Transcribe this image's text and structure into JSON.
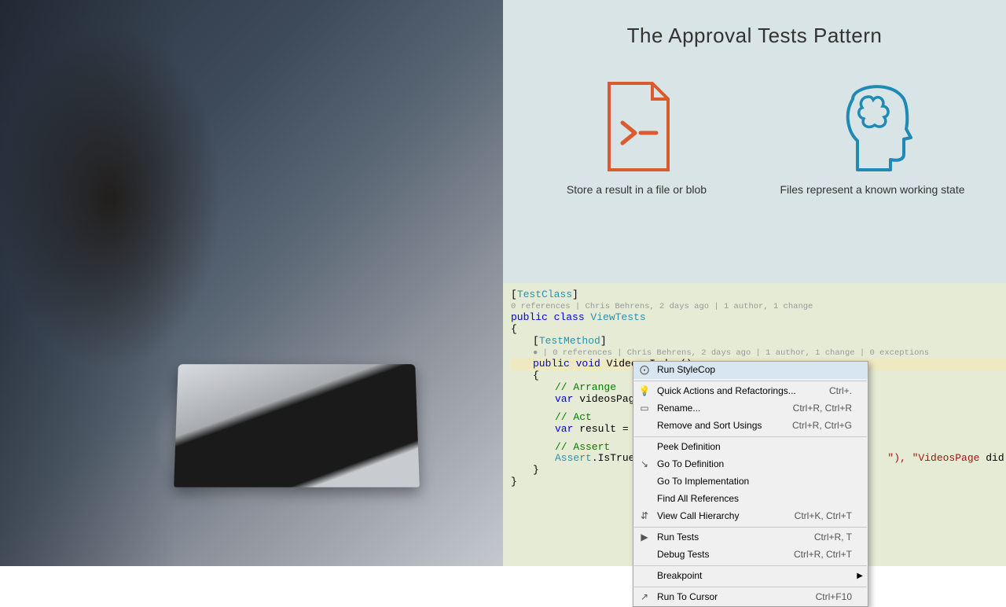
{
  "slide": {
    "title": "The Approval Tests Pattern",
    "concepts": [
      {
        "label": "Store a result in a file or blob"
      },
      {
        "label": "Files represent a known working state"
      }
    ]
  },
  "code": {
    "attr_testclass": "[TestClass]",
    "codelens1": "0 references | Chris Behrens, 2 days ago | 1 author, 1 change",
    "class_decl_kw": "public class ",
    "class_name": "ViewTests",
    "brace_open": "{",
    "attr_testmethod": "[TestMethod]",
    "codelens2": "● | 0 references | Chris Behrens, 2 days ago | 1 author, 1 change | 0 exceptions",
    "method_decl_kw": "public void ",
    "method_name": "Videos_Index()",
    "brace_open2": "{",
    "arrange": "// Arrange",
    "var1": "var videosPage",
    "act": "// Act",
    "var2": "var result = ",
    "assert": "// Assert",
    "assert_line_a": "Assert",
    "assert_line_b": ".IsTrue",
    "assert_tail_a": "\"),",
    "assert_tail_b": " \"VideosPage ",
    "assert_tail_c": "did not",
    "brace_close2": "}",
    "brace_close": "}"
  },
  "menu": {
    "items": [
      {
        "label": "Run StyleCop",
        "shortcut": "",
        "icon": "⨀"
      },
      {
        "label": "Quick Actions and Refactorings...",
        "shortcut": "Ctrl+.",
        "icon": "💡"
      },
      {
        "label": "Rename...",
        "shortcut": "Ctrl+R, Ctrl+R",
        "icon": "▭"
      },
      {
        "label": "Remove and Sort Usings",
        "shortcut": "Ctrl+R, Ctrl+G",
        "icon": ""
      },
      {
        "label": "Peek Definition",
        "shortcut": "",
        "icon": ""
      },
      {
        "label": "Go To Definition",
        "shortcut": "",
        "icon": "↘"
      },
      {
        "label": "Go To Implementation",
        "shortcut": "",
        "icon": ""
      },
      {
        "label": "Find All References",
        "shortcut": "",
        "icon": ""
      },
      {
        "label": "View Call Hierarchy",
        "shortcut": "Ctrl+K, Ctrl+T",
        "icon": "⇵"
      },
      {
        "label": "Run Tests",
        "shortcut": "Ctrl+R, T",
        "icon": "▶"
      },
      {
        "label": "Debug Tests",
        "shortcut": "Ctrl+R, Ctrl+T",
        "icon": ""
      },
      {
        "label": "Breakpoint",
        "shortcut": "",
        "icon": "",
        "submenu": true
      },
      {
        "label": "Run To Cursor",
        "shortcut": "Ctrl+F10",
        "icon": "↗"
      }
    ],
    "separators_after": [
      0,
      3,
      8,
      10,
      11
    ]
  }
}
